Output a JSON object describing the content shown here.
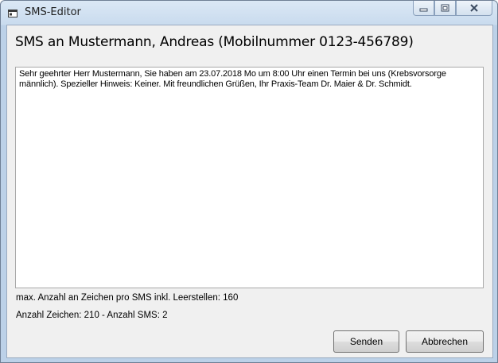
{
  "window": {
    "title": "SMS-Editor",
    "icon": "sms-window-icon",
    "controls": [
      "minimize-icon",
      "maximize-icon",
      "close-icon"
    ]
  },
  "heading": "SMS an Mustermann, Andreas (Mobilnummer 0123-456789)",
  "message": {
    "text": "Sehr geehrter Herr Mustermann, Sie haben am 23.07.2018 Mo um 8:00 Uhr einen Termin bei uns (Krebsvorsorge männlich). Spezieller Hinweis: Keiner. Mit freundlichen Grüßen, Ihr Praxis-Team Dr. Maier & Dr. Schmidt."
  },
  "info": {
    "max_chars": "max. Anzahl an Zeichen pro SMS inkl. Leerstellen: 160",
    "count": "Anzahl Zeichen: 210 - Anzahl SMS: 2"
  },
  "buttons": {
    "send": "Senden",
    "cancel": "Abbrechen"
  },
  "colors": {
    "titlebar": "#c9dbee",
    "client": "#f0f0f0",
    "button_border": "#707070"
  }
}
